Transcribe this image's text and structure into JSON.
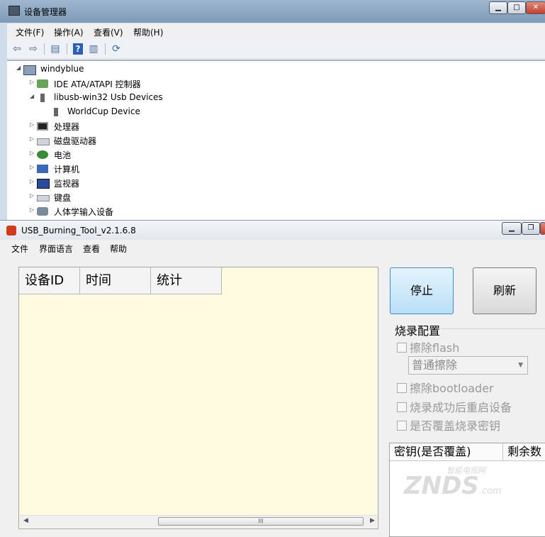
{
  "device_manager": {
    "title": "设备管理器",
    "menu": [
      "文件(F)",
      "操作(A)",
      "查看(V)",
      "帮助(H)"
    ],
    "tree": {
      "root": "windyblue",
      "nodes": [
        {
          "label": "IDE ATA/ATAPI 控制器",
          "icon": "ide-controller-icon",
          "expanded": false
        },
        {
          "label": "libusb-win32 Usb Devices",
          "icon": "usb-device-icon",
          "expanded": true
        },
        {
          "label": "WorldCup Device",
          "icon": "usb-device-icon",
          "child": true
        },
        {
          "label": "处理器",
          "icon": "processor-icon",
          "expanded": false
        },
        {
          "label": "磁盘驱动器",
          "icon": "disk-drive-icon",
          "expanded": false
        },
        {
          "label": "电池",
          "icon": "battery-icon",
          "expanded": false
        },
        {
          "label": "计算机",
          "icon": "computer-icon",
          "expanded": false
        },
        {
          "label": "监视器",
          "icon": "monitor-icon",
          "expanded": false
        },
        {
          "label": "键盘",
          "icon": "keyboard-icon",
          "expanded": false
        },
        {
          "label": "人体学输入设备",
          "icon": "hid-icon",
          "expanded": false
        }
      ]
    }
  },
  "usb_tool": {
    "title": "USB_Burning_Tool_v2.1.6.8",
    "menu": [
      "文件",
      "界面语言",
      "查看",
      "帮助"
    ],
    "columns": [
      "设备ID",
      "时间",
      "统计"
    ],
    "stop_label": "停止",
    "refresh_label": "刷新",
    "config_title": "烧录配置",
    "erase_flash": "擦除flash",
    "erase_mode": "普通擦除",
    "erase_bootloader": "擦除bootloader",
    "reboot_after": "烧录成功后重启设备",
    "overwrite_key": "是否覆盖烧录密钥",
    "key_columns": [
      "密钥(是否覆盖)",
      "剩余数"
    ],
    "scroll_grip": "III"
  },
  "watermark": {
    "text": "ZNDS",
    "suffix": ".com",
    "top": "智能电视网"
  }
}
